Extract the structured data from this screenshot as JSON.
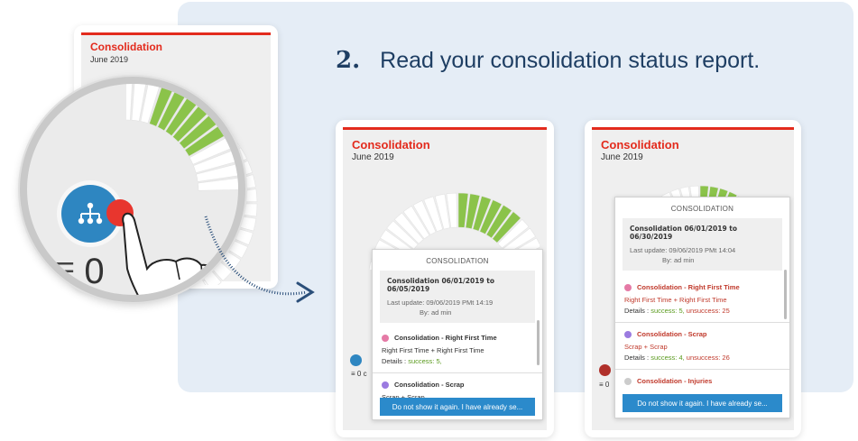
{
  "step": {
    "number": "2.",
    "text": "Read your consolidation status report."
  },
  "cards": [
    {
      "title": "Consolidation",
      "date": "June 2019"
    },
    {
      "title": "Consolidation",
      "date": "June 2019"
    },
    {
      "title": "Consolidation",
      "date": "June 2019"
    }
  ],
  "magnifier": {
    "count": "0"
  },
  "popup_left": {
    "header": "CONSOLIDATION",
    "range": "Consolidation 06/01/2019 to 06/05/2019",
    "last_update_label": "Last update:",
    "last_update_value": "09/06/2019 PMt 14:19",
    "by_label": "By:",
    "by_value": "ad min",
    "sections": [
      {
        "title": "Consolidation - Right First Time",
        "line": "Right First Time + Right First Time",
        "details_label": "Details :",
        "success": "success: 5,",
        "unsuccess": ""
      },
      {
        "title": "Consolidation - Scrap",
        "line": "Scrap + Scrap",
        "details_label": "",
        "success": "",
        "unsuccess": ""
      }
    ],
    "button": "Do not show it again. I have already se...",
    "count": "0 c"
  },
  "popup_right": {
    "header": "CONSOLIDATION",
    "range": "Consolidation 06/01/2019 to 06/30/2019",
    "last_update_label": "Last update:",
    "last_update_value": "09/06/2019 PMt 14:04",
    "by_label": "By:",
    "by_value": "ad min",
    "sections": [
      {
        "title": "Consolidation - Right First Time",
        "line": "Right First Time + Right First Time",
        "details_label": "Details :",
        "success": "success: 5,",
        "unsuccess": "unsuccess: 25"
      },
      {
        "title": "Consolidation - Scrap",
        "line": "Scrap + Scrap",
        "details_label": "Details :",
        "success": "success: 4,",
        "unsuccess": "unsuccess: 26"
      },
      {
        "title": "Consolidation - Injuries",
        "line": "",
        "details_label": "",
        "success": "",
        "unsuccess": ""
      }
    ],
    "button": "Do not show it again. I have already se...",
    "count": "0"
  },
  "colors": {
    "accent_red": "#e32b1d",
    "gauge_green": "#8bc34a",
    "button_blue": "#2b8acb",
    "panel_bg": "#e5edf6",
    "heading": "#1e3e63",
    "dot_pink": "#e57aa6",
    "dot_purple": "#9b7be0",
    "dot_gray": "#cccccc"
  },
  "icons": [
    "hierarchy-icon",
    "list-icon",
    "hand-pointer-icon",
    "curved-arrow-icon"
  ]
}
